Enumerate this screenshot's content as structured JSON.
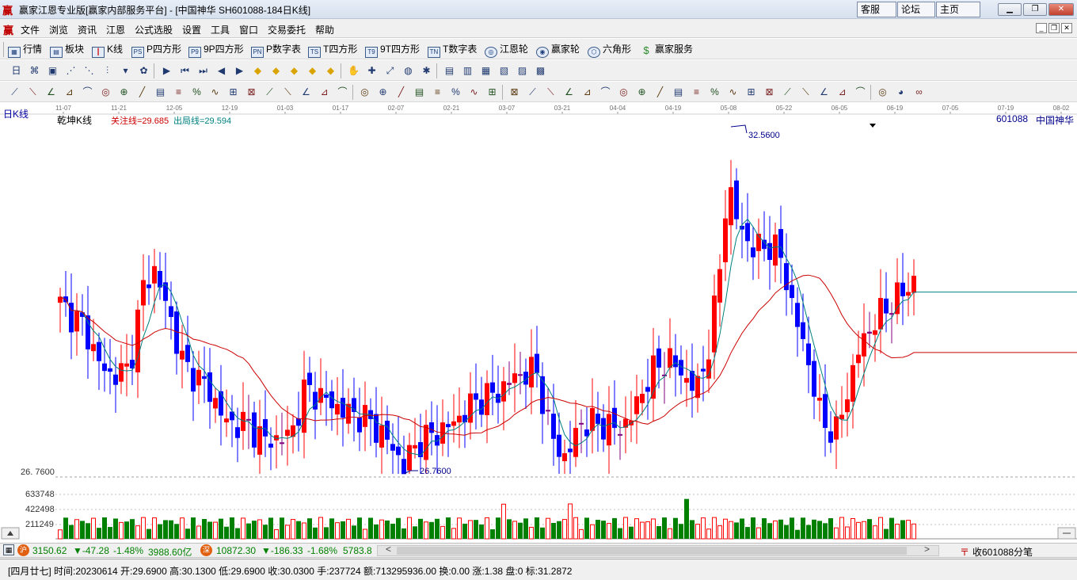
{
  "window": {
    "logo": "赢",
    "title": "赢家江恩专业版[赢家内部服务平台] - [中国神华  SH601088-184日K线]",
    "links": [
      "客服",
      "论坛",
      "主页"
    ]
  },
  "menu": {
    "logo": "赢",
    "items": [
      "文件",
      "浏览",
      "资讯",
      "江恩",
      "公式选股",
      "设置",
      "工具",
      "窗口",
      "交易委托",
      "帮助"
    ]
  },
  "toolbar1": {
    "items": [
      {
        "label": "行情",
        "icon": "quote-table-icon"
      },
      {
        "label": "板块",
        "icon": "sector-icon"
      },
      {
        "label": "K线",
        "icon": "kline-icon"
      },
      {
        "label": "P四方形",
        "icon": "p-square-icon"
      },
      {
        "label": "9P四方形",
        "icon": "9p-square-icon"
      },
      {
        "label": "P数字表",
        "icon": "p-number-table-icon"
      },
      {
        "label": "T四方形",
        "icon": "t-square-icon"
      },
      {
        "label": "9T四方形",
        "icon": "9t-square-icon"
      },
      {
        "label": "T数字表",
        "icon": "t-number-table-icon"
      },
      {
        "label": "江恩轮",
        "icon": "gann-wheel-icon"
      },
      {
        "label": "赢家轮",
        "icon": "winner-wheel-icon"
      },
      {
        "label": "六角形",
        "icon": "hexagon-icon"
      },
      {
        "label": "赢家服务",
        "icon": "dollar-icon"
      }
    ]
  },
  "chart": {
    "period_label": "日K线",
    "indicator_name": "乾坤K线",
    "focus_line": "关注线=29.685",
    "exit_line": "出局线=29.594",
    "stock_code": "601088",
    "stock_name": "中国神华",
    "date_ticks": [
      "11-07",
      "11-21",
      "12-05",
      "12-19",
      "01-03",
      "01-17",
      "02-07",
      "02-21",
      "03-07",
      "03-21",
      "04-04",
      "04-19",
      "05-08",
      "05-22",
      "06-05",
      "06-19",
      "07-05",
      "07-19",
      "08-02"
    ],
    "high_label": "32.5600",
    "low_label": "26.7600",
    "price_axis_label": "26. 7600",
    "volume_axis_labels": [
      "633748",
      "422498",
      "211249"
    ],
    "colors": {
      "up": "#ff0000",
      "down": "#0000ff",
      "flat": "#800080",
      "ma_fast": "#008080",
      "ma_slow": "#cc0000",
      "volume_up": "#ff0000",
      "volume_down": "#008000"
    }
  },
  "index_bar": {
    "sh_value": "3150.62",
    "sh_change": "▼-47.28",
    "sh_pct": "-1.48%",
    "sh_amount": "3988.60亿",
    "sz_value": "10872.30",
    "sz_change": "▼-186.33",
    "sz_pct": "-1.68%",
    "sz_amount": "5783.8",
    "right_text": "收601088分笔"
  },
  "status": {
    "text": "[四月廿七] 时间:20230614 开:29.6900 高:30.1300 低:29.6900 收:30.0300 手:237724 额:713295936.00 换:0.00 涨:1.38 盘:0 标:31.2872"
  }
}
